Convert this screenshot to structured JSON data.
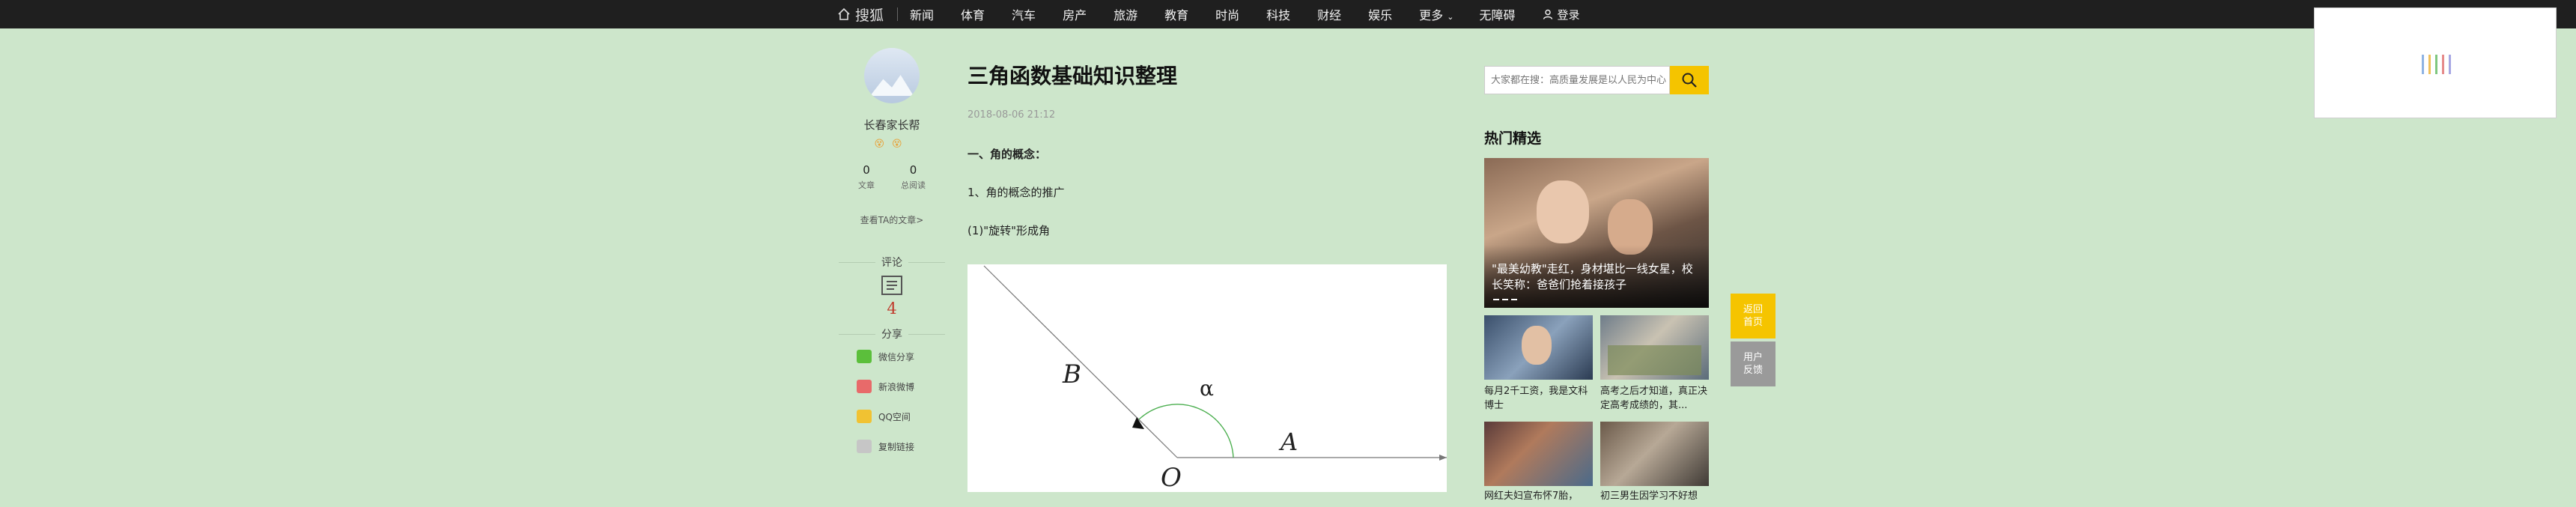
{
  "nav": {
    "brand": "搜狐",
    "items": [
      "新闻",
      "体育",
      "汽车",
      "房产",
      "旅游",
      "教育",
      "时尚",
      "科技",
      "财经",
      "娱乐"
    ],
    "more": "更多",
    "accessibility": "无障碍",
    "login": "登录"
  },
  "author": {
    "name": "长春家长帮",
    "emoji": "😵😵",
    "articles_count": "0",
    "articles_label": "文章",
    "views_count": "0",
    "views_label": "总阅读",
    "view_articles_link": "查看TA的文章>",
    "comments_label": "评论",
    "comments_count": "4",
    "share_label": "分享",
    "share_items": [
      {
        "label": "微信分享",
        "color": "#5bbf3b"
      },
      {
        "label": "新浪微博",
        "color": "#e86a6a"
      },
      {
        "label": "QQ空间",
        "color": "#f1c232"
      },
      {
        "label": "复制链接",
        "color": "#c6c6c6"
      }
    ]
  },
  "article": {
    "title": "三角函数基础知识整理",
    "date": "2018-08-06 21:12",
    "para1": "一、角的概念：",
    "para2": "1、角的概念的推广",
    "para3": "(1)\"旋转\"形成角",
    "figure_labels": {
      "B": "B",
      "alpha": "α",
      "A": "A",
      "O": "O"
    }
  },
  "sidebar": {
    "search_placeholder": "大家都在搜：高质量发展是以人民为中心",
    "hot_title": "热门精选",
    "hero_caption": "\"最美幼教\"走红，身材堪比一线女星，校长笑称：爸爸们抢着接孩子",
    "items": [
      {
        "caption": "每月2千工资，我是文科博士"
      },
      {
        "caption": "高考之后才知道，真正决定高考成绩的，其..."
      },
      {
        "caption": "网红夫妇宣布怀7胎，"
      },
      {
        "caption": "初三男生因学习不好想"
      }
    ]
  },
  "float": {
    "home": "返回首页",
    "feedback": "用户反馈"
  },
  "colors": {
    "accent": "#f5c400",
    "topbar": "#1f1f1f",
    "page_bg": "#cde6cb",
    "comment_red": "#c0392b",
    "feedback_gray": "#9a9a9a"
  },
  "loader": {
    "bar_colors": [
      "#8fb3e3",
      "#f0c05a",
      "#7fc77f",
      "#e58a8a",
      "#a7a7e3"
    ]
  }
}
